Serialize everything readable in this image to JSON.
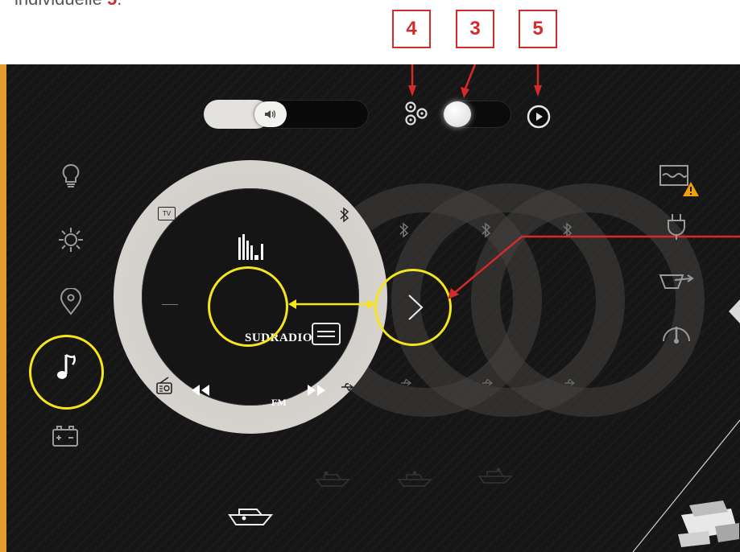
{
  "caption": {
    "text": "individuelle",
    "number": "5",
    "suffix": "."
  },
  "callouts": [
    "4",
    "3",
    "5"
  ],
  "volume": {
    "level_percent": 38
  },
  "sidebar_left": [
    "light-bulb-icon",
    "climate-icon",
    "location-pin-icon",
    "music-note-icon",
    "battery-icon"
  ],
  "sidebar_right": [
    "water-tank-warning-icon",
    "shore-power-plug-icon",
    "wiper-icon",
    "gauge-icon"
  ],
  "audio": {
    "source_label": "TV",
    "station": "SUDRADIO",
    "band": "FM"
  },
  "colors": {
    "accent_yellow": "#f5e51a",
    "callout_red": "#d42a2a",
    "ring": "#d6d3ce"
  }
}
